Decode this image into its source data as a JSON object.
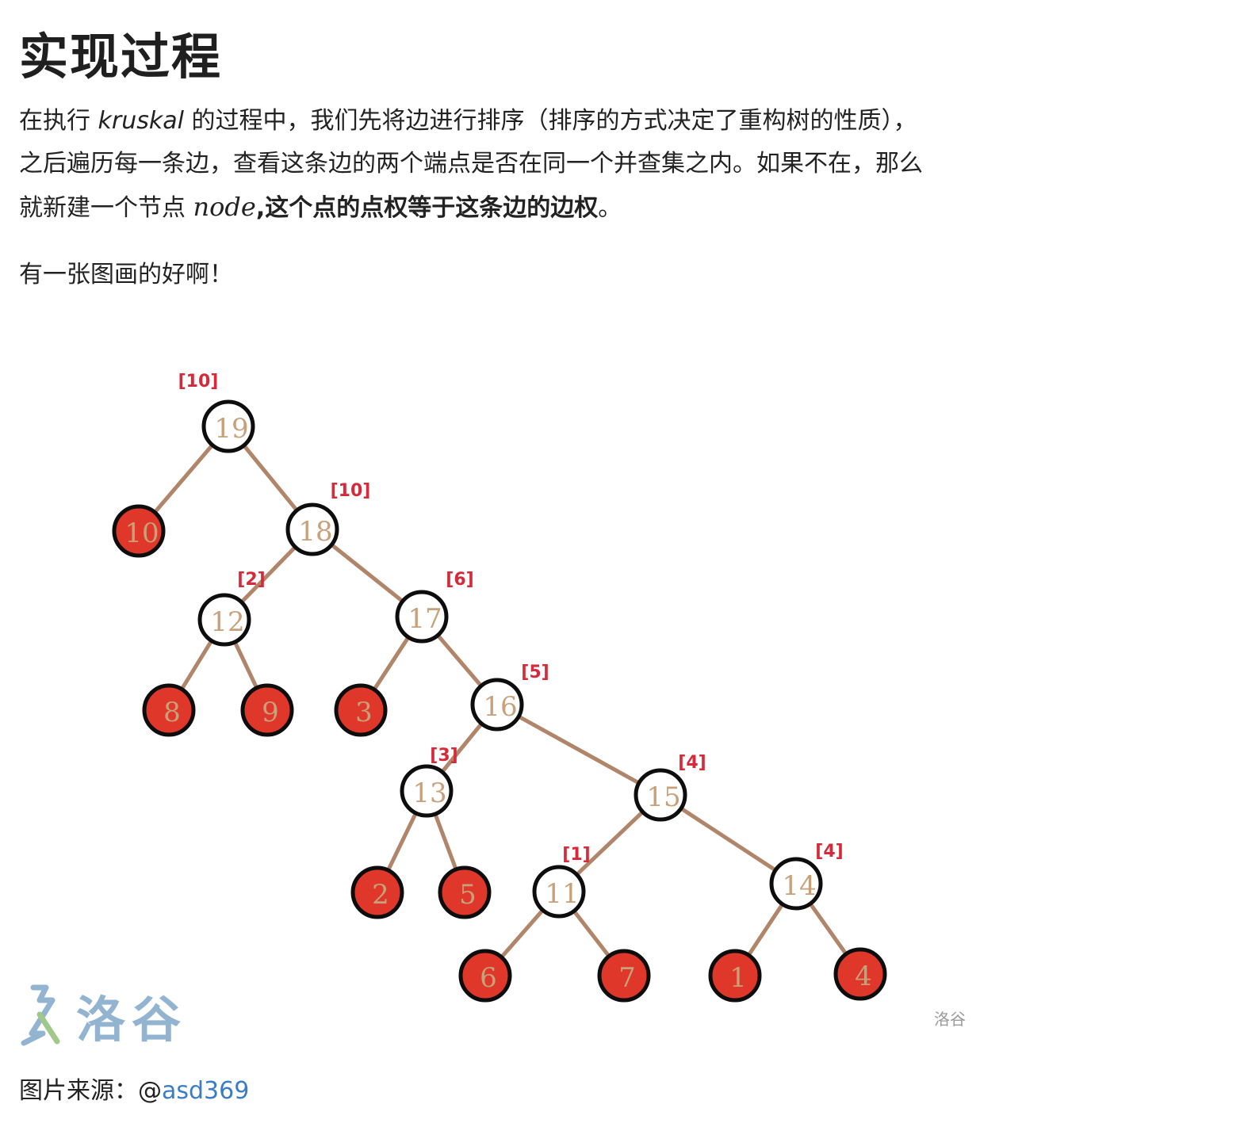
{
  "heading": "实现过程",
  "paragraph": {
    "part1": "在执行 ",
    "kruskal": "kruskal",
    "part2": " 的过程中，我们先将边进行排序（排序的方式决定了重构树的性质），",
    "line2": "之后遍历每一条边，查看这条边的两个端点是否在同一个并查集之内。如果不在，那么",
    "line3_start": "就新建一个节点 ",
    "node_math": "node",
    "line3_bold": ",这个点的点权等于这条边的边权",
    "line3_end": "。"
  },
  "paragraph2": "有一张图画的好啊！",
  "figure": {
    "watermark_logo_text": "洛谷",
    "watermark_small": "洛谷",
    "colors": {
      "edge": "#b0856a",
      "leaf_fill": "#e0372b",
      "node_stroke": "#0d0d0d",
      "label_text": "#c8a07a",
      "weight_text": "#d62a3a"
    },
    "nodes": [
      {
        "label": "19",
        "leaf": false,
        "weight": "[10]"
      },
      {
        "label": "10",
        "leaf": true
      },
      {
        "label": "18",
        "leaf": false,
        "weight": "[10]"
      },
      {
        "label": "12",
        "leaf": false,
        "weight": "[2]"
      },
      {
        "label": "17",
        "leaf": false,
        "weight": "[6]"
      },
      {
        "label": "8",
        "leaf": true
      },
      {
        "label": "9",
        "leaf": true
      },
      {
        "label": "3",
        "leaf": true
      },
      {
        "label": "16",
        "leaf": false,
        "weight": "[5]"
      },
      {
        "label": "13",
        "leaf": false,
        "weight": "[3]"
      },
      {
        "label": "15",
        "leaf": false,
        "weight": "[4]"
      },
      {
        "label": "2",
        "leaf": true
      },
      {
        "label": "5",
        "leaf": true
      },
      {
        "label": "11",
        "leaf": false,
        "weight": "[1]"
      },
      {
        "label": "14",
        "leaf": false,
        "weight": "[4]"
      },
      {
        "label": "6",
        "leaf": true
      },
      {
        "label": "7",
        "leaf": true
      },
      {
        "label": "1",
        "leaf": true
      },
      {
        "label": "4",
        "leaf": true
      }
    ],
    "edges": [
      [
        "19",
        "10"
      ],
      [
        "19",
        "18"
      ],
      [
        "18",
        "12"
      ],
      [
        "18",
        "17"
      ],
      [
        "12",
        "8"
      ],
      [
        "12",
        "9"
      ],
      [
        "17",
        "3"
      ],
      [
        "17",
        "16"
      ],
      [
        "16",
        "13"
      ],
      [
        "16",
        "15"
      ],
      [
        "13",
        "2"
      ],
      [
        "13",
        "5"
      ],
      [
        "15",
        "11"
      ],
      [
        "15",
        "14"
      ],
      [
        "11",
        "6"
      ],
      [
        "11",
        "7"
      ],
      [
        "14",
        "1"
      ],
      [
        "14",
        "4"
      ]
    ]
  },
  "caption": {
    "prefix": "图片来源：@",
    "link": "asd369"
  }
}
